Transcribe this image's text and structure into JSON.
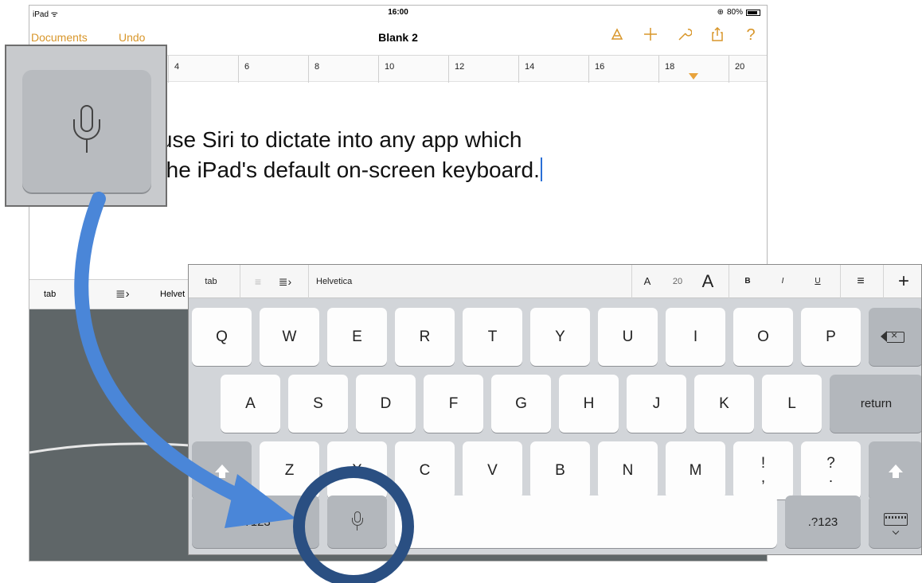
{
  "status": {
    "device": "iPad",
    "time": "16:00",
    "battery": "80%"
  },
  "nav": {
    "documents": "Documents",
    "undo": "Undo",
    "title": "Blank 2",
    "icons": [
      "paintbrush-icon",
      "plus-icon",
      "wrench-icon",
      "share-icon",
      "help-icon"
    ],
    "help_glyph": "?",
    "accent_color": "#d8962a"
  },
  "ruler": {
    "labels": [
      "4",
      "6",
      "8",
      "10",
      "12",
      "14",
      "16",
      "18",
      "20"
    ]
  },
  "document": {
    "line1": "an use Siri to dictate into any app which",
    "line2": "rts the iPad's default on-screen keyboard."
  },
  "bg_toolbar": {
    "tab": "tab",
    "font": "Helvet"
  },
  "kb_toolbar": {
    "tab": "tab",
    "font": "Helvetica",
    "size_small": "A",
    "size": "20",
    "size_large": "A",
    "bold": "B",
    "italic": "I",
    "underline": "U",
    "plus": "+"
  },
  "keyboard": {
    "row1": [
      "Q",
      "W",
      "E",
      "R",
      "T",
      "Y",
      "U",
      "I",
      "O",
      "P"
    ],
    "row2": [
      "A",
      "S",
      "D",
      "F",
      "G",
      "H",
      "J",
      "K",
      "L"
    ],
    "row3": [
      "Z",
      "X",
      "C",
      "V",
      "B",
      "N",
      "M"
    ],
    "return": "return",
    "exclaim_top": "!",
    "exclaim_bottom": ",",
    "question_top": "?",
    "question_bottom": ".",
    "numbers_left": ".?123",
    "numbers_right": ".?123"
  },
  "annotation": {
    "arrow_color": "#4a86d8",
    "ring_color": "#2a4f82"
  }
}
